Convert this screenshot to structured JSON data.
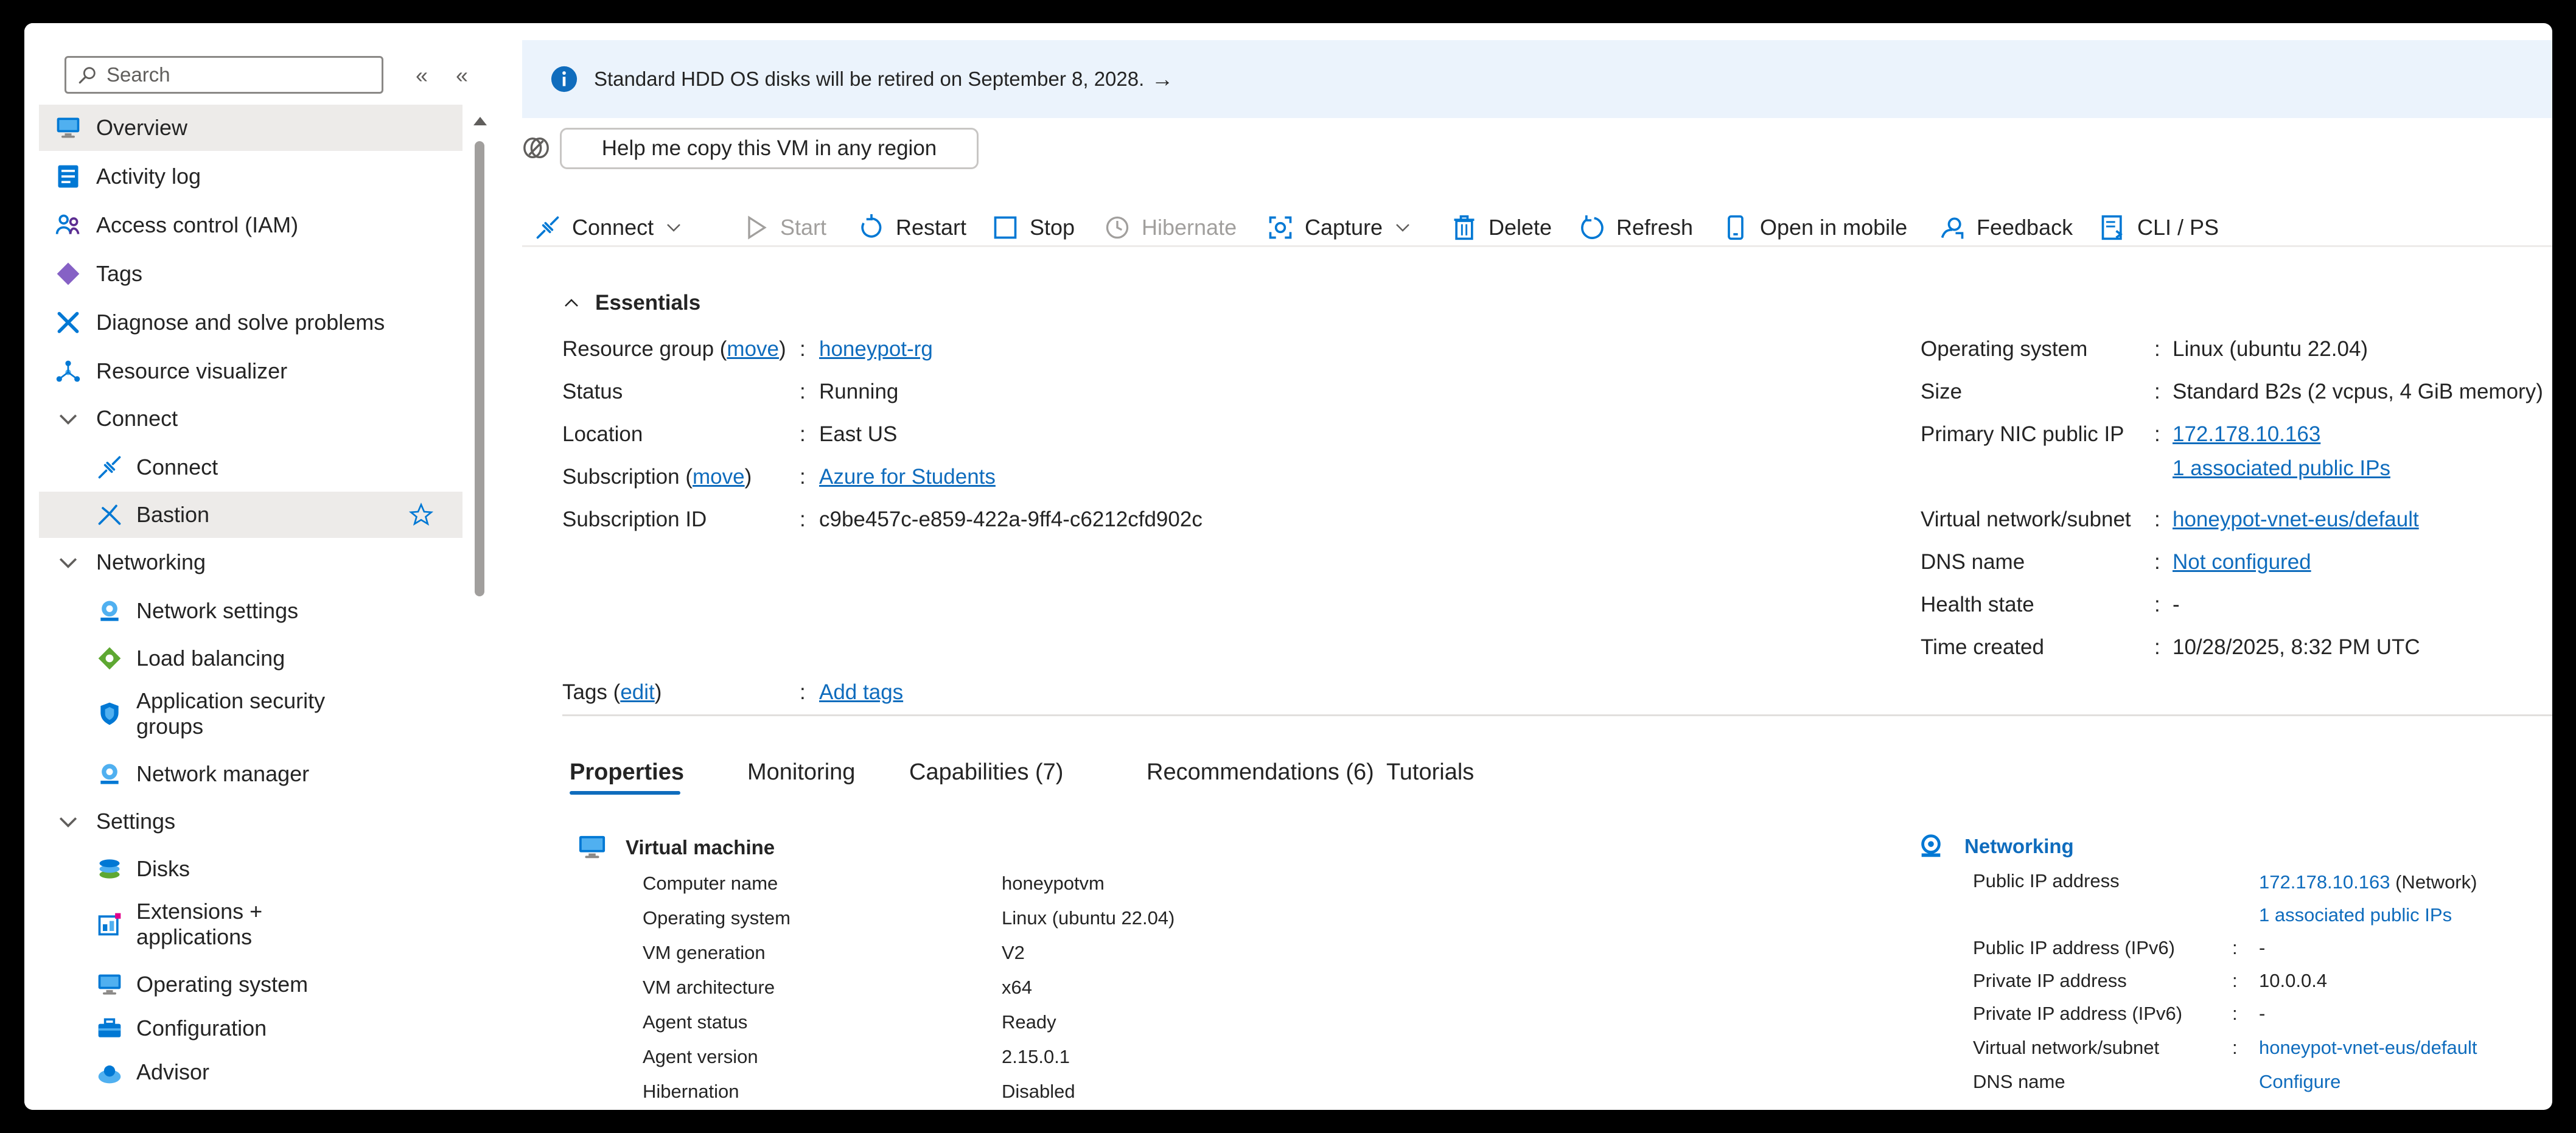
{
  "sidebar": {
    "search_placeholder": "Search",
    "items": [
      {
        "label": "Overview"
      },
      {
        "label": "Activity log"
      },
      {
        "label": "Access control (IAM)"
      },
      {
        "label": "Tags"
      },
      {
        "label": "Diagnose and solve problems"
      },
      {
        "label": "Resource visualizer"
      },
      {
        "label": "Connect"
      },
      {
        "label": "Connect"
      },
      {
        "label": "Bastion"
      },
      {
        "label": "Networking"
      },
      {
        "label": "Network settings"
      },
      {
        "label": "Load balancing"
      },
      {
        "label": "Application security groups",
        "line1": "Application security",
        "line2": "groups"
      },
      {
        "label": "Network manager"
      },
      {
        "label": "Settings"
      },
      {
        "label": "Disks"
      },
      {
        "label": "Extensions + applications",
        "line1": "Extensions +",
        "line2": "applications"
      },
      {
        "label": "Operating system"
      },
      {
        "label": "Configuration"
      },
      {
        "label": "Advisor"
      }
    ]
  },
  "banner": {
    "text": "Standard HDD OS disks will be retired on September 8, 2028.",
    "arrow": "→"
  },
  "copy_vm_label": "Help me copy this VM in any region",
  "toolbar": {
    "connect": "Connect",
    "start": "Start",
    "restart": "Restart",
    "stop": "Stop",
    "hibernate": "Hibernate",
    "capture": "Capture",
    "delete": "Delete",
    "refresh": "Refresh",
    "open_mobile": "Open in mobile",
    "feedback": "Feedback",
    "cli": "CLI / PS"
  },
  "essentials": {
    "title": "Essentials",
    "left": {
      "rg_label": "Resource group (",
      "move": "move",
      "rg_label_end": ")",
      "rg_value": "honeypot-rg",
      "status_label": "Status",
      "status_value": "Running",
      "location_label": "Location",
      "location_value": "East US",
      "sub_label": "Subscription (",
      "sub_value": "Azure for Students",
      "subid_label": "Subscription ID",
      "subid_value": "c9be457c-e859-422a-9ff4-c6212cfd902c",
      "tags_label": "Tags (",
      "edit": "edit",
      "tags_value": "Add tags"
    },
    "right": {
      "os_label": "Operating system",
      "os_value": "Linux (ubuntu 22.04)",
      "size_label": "Size",
      "size_value": "Standard B2s (2 vcpus, 4 GiB memory)",
      "nic_label": "Primary NIC public IP",
      "nic_value": "172.178.10.163",
      "nic_value2": "1 associated public IPs",
      "vnet_label": "Virtual network/subnet",
      "vnet_value": "honeypot-vnet-eus/default",
      "dns_label": "DNS name",
      "dns_value": "Not configured",
      "health_label": "Health state",
      "health_value": "-",
      "time_label": "Time created",
      "time_value": "10/28/2025, 8:32 PM UTC"
    },
    "colon": ":"
  },
  "tabs": [
    "Properties",
    "Monitoring",
    "Capabilities (7)",
    "Recommendations (6)",
    "Tutorials"
  ],
  "vm_section": {
    "title": "Virtual machine",
    "rows": [
      {
        "label": "Computer name",
        "value": "honeypotvm"
      },
      {
        "label": "Operating system",
        "value": "Linux (ubuntu 22.04)"
      },
      {
        "label": "VM generation",
        "value": "V2"
      },
      {
        "label": "VM architecture",
        "value": "x64"
      },
      {
        "label": "Agent status",
        "value": "Ready"
      },
      {
        "label": "Agent version",
        "value": "2.15.0.1"
      },
      {
        "label": "Hibernation",
        "value": "Disabled"
      }
    ]
  },
  "net_section": {
    "title": "Networking",
    "public_ip_label": "Public IP address",
    "public_ip_value": "172.178.10.163",
    "public_ip_suffix": " (Network)",
    "public_ip_assoc": "1 associated public IPs",
    "ipv6_label": "Public IP address (IPv6)",
    "ipv6_value": "-",
    "private_label": "Private IP address",
    "private_value": "10.0.0.4",
    "private6_label": "Private IP address (IPv6)",
    "private6_value": "-",
    "vnet_label": "Virtual network/subnet",
    "vnet_value": "honeypot-vnet-eus/default",
    "dns_label": "DNS name",
    "dns_value": "Configure"
  }
}
